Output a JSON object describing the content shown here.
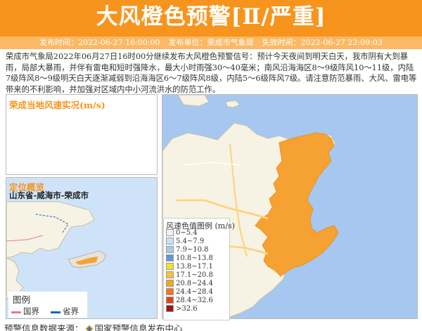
{
  "header": {
    "title": "大风橙色预警[Ⅱ/严重]",
    "publish_time": "发布时间：2022-06-27 16:00:00",
    "publisher": "发布单位：荣成市气象局",
    "expire_time": "失效时间：2022-06-27 22:09:03",
    "bg_color": "#f7941d",
    "meta_bg_color": "#fbb865"
  },
  "content": "荣成市气象局2022年06月27日16时00分继续发布大风橙色预警信号：预计今天夜间到明天白天，我市阴有大到暴雨，局部大暴雨，并伴有雷电和短时强降水，最大小时雨强30～40毫米；南风沿海海区8～9级阵风10～11级，内陆7级阵风8～9级明天白天逐渐减弱到沿海海区6～7级阵风8级，内陆5～6级阵风7级。请注意防范暴雨、大风、雷电等带来的不利影响，并加强对区域内中小河流洪水的防范工作。",
  "wind_panel": {
    "title": "荣成当地风速实况(m/s)"
  },
  "location_panel": {
    "title": "定位概览",
    "region": "山东省-威海市-荣成市"
  },
  "map_legend": {
    "title": "图例",
    "items": [
      {
        "label": "国界",
        "color": "#e87a8c"
      },
      {
        "label": "省界",
        "color": "#1f5fd1"
      }
    ]
  },
  "wind_scale": {
    "title": "风速色值图例 (m/s)",
    "items": [
      {
        "label": "0~5.4",
        "color": "#f0f0f0"
      },
      {
        "label": "5.4~7.9",
        "color": "#c6e2f7"
      },
      {
        "label": "7.9~10.8",
        "color": "#a3cdef"
      },
      {
        "label": "10.8~13.8",
        "color": "#5b9ad6"
      },
      {
        "label": "13.8~17.1",
        "color": "#f4e21c"
      },
      {
        "label": "17.1~20.8",
        "color": "#f7c23a"
      },
      {
        "label": "20.8~24.4",
        "color": "#f5a623"
      },
      {
        "label": "24.4~28.4",
        "color": "#ef7a1a"
      },
      {
        "label": "28.4~32.6",
        "color": "#e0441a"
      },
      {
        "label": ">32.6",
        "color": "#a31515"
      }
    ]
  },
  "alert_area_color": "#f5a233",
  "footer": {
    "source_label": "预警信息数据来源：",
    "source_name": "国家预警信息发布中心"
  }
}
